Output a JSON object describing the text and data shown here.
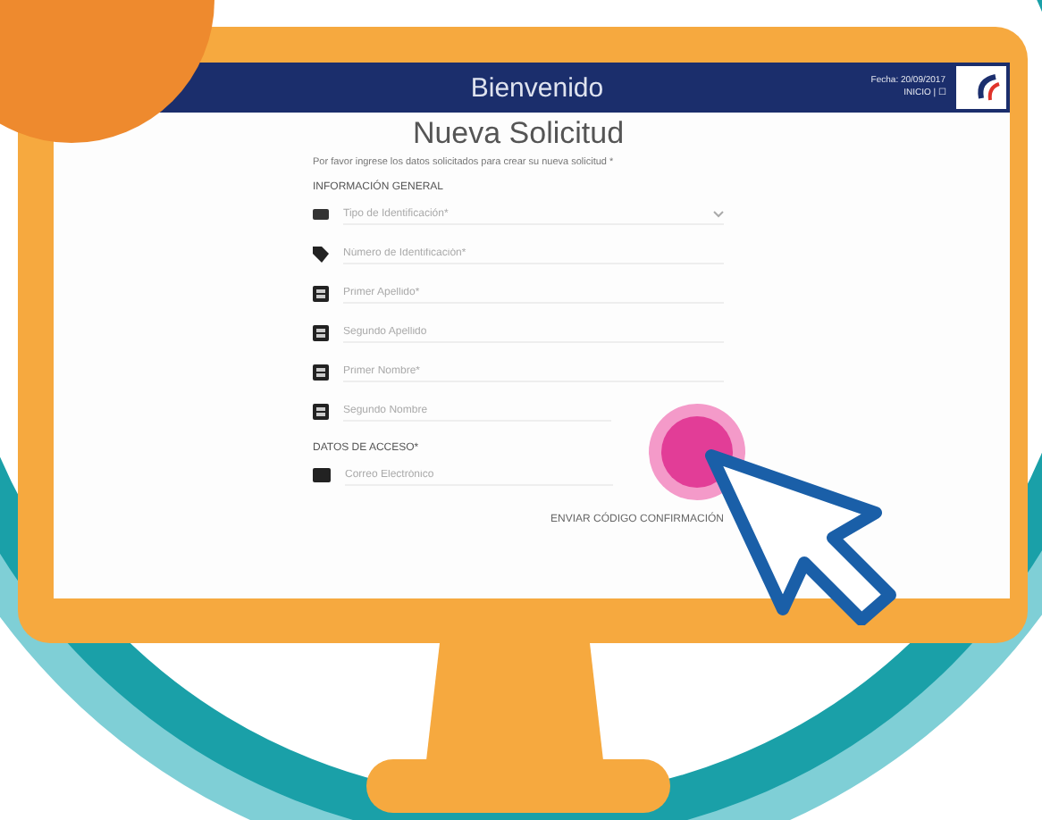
{
  "header": {
    "title": "Bienvenido",
    "user_line": "Fecha: 20/09/2017",
    "user_name": "INICIO | ☐"
  },
  "form": {
    "title": "Nueva Solicitud",
    "instructions": "Por favor ingrese los datos solicitados para crear su nueva solicitud *",
    "sections": [
      {
        "heading": "INFORMACIÓN GENERAL",
        "fields": [
          {
            "kind": "select",
            "placeholder": "Tipo de Identificación*"
          },
          {
            "kind": "text",
            "placeholder": "Número de Identificación*"
          },
          {
            "kind": "text",
            "placeholder": "Primer Apellido*"
          },
          {
            "kind": "text",
            "placeholder": "Segundo Apellido"
          },
          {
            "kind": "text",
            "placeholder": "Primer Nombre*"
          },
          {
            "kind": "text",
            "placeholder": "Segundo Nombre"
          }
        ]
      },
      {
        "heading": "DATOS DE ACCESO*",
        "fields": [
          {
            "kind": "text",
            "placeholder": "Correo Electrónico"
          }
        ]
      }
    ],
    "submit": "ENVIAR CÓDIGO CONFIRMACIÓN"
  }
}
